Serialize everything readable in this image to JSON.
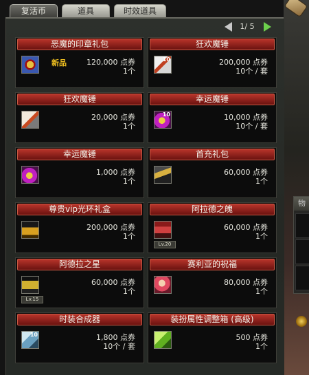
{
  "tabs": [
    {
      "label": "复活币",
      "active": true
    },
    {
      "label": "道具",
      "active": false
    },
    {
      "label": "时效道具",
      "active": false
    }
  ],
  "pager": {
    "current": 1,
    "total": 5,
    "text": "1/ 5"
  },
  "side_panel": {
    "tab_label": "物"
  },
  "items": [
    {
      "name": "恶魔的印章礼包",
      "price": "120,000 点券",
      "qty": "1个",
      "badge": "新品",
      "icon": "demon-seal-icon",
      "stack": ""
    },
    {
      "name": "狂欢魔锤",
      "price": "200,000 点券",
      "qty": "10个 / 套",
      "badge": "",
      "icon": "carnival-hammer-box-icon",
      "stack": "10"
    },
    {
      "name": "狂欢魔锤",
      "price": "20,000 点券",
      "qty": "1个",
      "badge": "",
      "icon": "carnival-hammer-box-icon",
      "stack": ""
    },
    {
      "name": "幸运魔锤",
      "price": "10,000 点券",
      "qty": "10个 / 套",
      "badge": "",
      "icon": "lucky-hammer-icon",
      "stack": "10"
    },
    {
      "name": "幸运魔锤",
      "price": "1,000 点券",
      "qty": "1个",
      "badge": "",
      "icon": "lucky-hammer-icon",
      "stack": ""
    },
    {
      "name": "首充礼包",
      "price": "60,000 点券",
      "qty": "1个",
      "badge": "",
      "icon": "first-charge-gift-icon",
      "stack": ""
    },
    {
      "name": "尊贵vip光环礼盒",
      "price": "200,000 点券",
      "qty": "1个",
      "badge": "",
      "icon": "vip-trophy-icon",
      "stack": ""
    },
    {
      "name": "阿拉德之魄",
      "price": "60,000 点券",
      "qty": "1个",
      "badge": "",
      "icon": "fairy-knight-icon",
      "stack": "",
      "level": "Lv.20"
    },
    {
      "name": "阿德拉之星",
      "price": "60,000 点券",
      "qty": "1个",
      "badge": "",
      "icon": "gold-emblem-icon",
      "stack": "",
      "level": "Lv.15"
    },
    {
      "name": "赛利亚的祝福",
      "price": "80,000 点券",
      "qty": "1个",
      "badge": "",
      "icon": "seria-portrait-icon",
      "stack": ""
    },
    {
      "name": "时装合成器",
      "price": "1,800 点券",
      "qty": "10个 / 套",
      "badge": "",
      "icon": "crystal-synthesizer-icon",
      "stack": "10"
    },
    {
      "name": "装扮属性调整箱 (高级)",
      "price": "500 点券",
      "qty": "1个",
      "badge": "",
      "icon": "green-cube-icon",
      "stack": ""
    }
  ]
}
